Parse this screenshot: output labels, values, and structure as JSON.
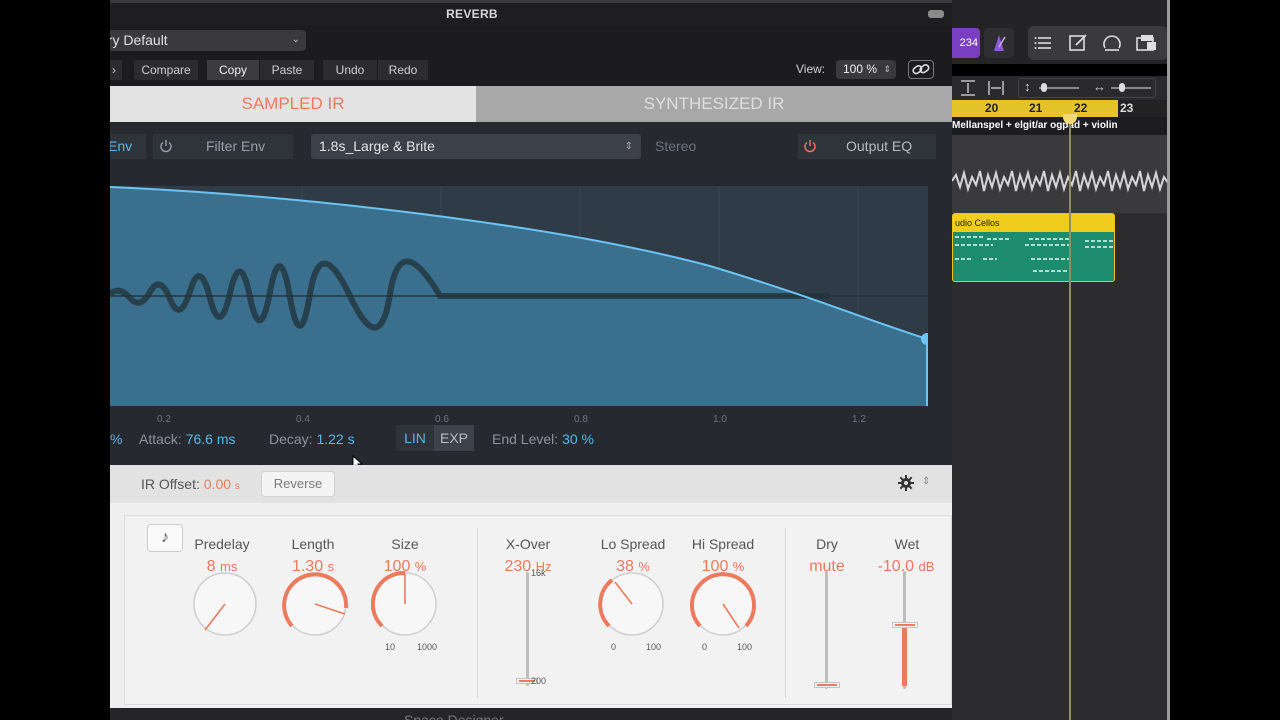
{
  "plugin": {
    "title": "REVERB",
    "preset": "ory Default",
    "toolbar": {
      "arrow": "›",
      "compare": "Compare",
      "copy": "Copy",
      "paste": "Paste",
      "undo": "Undo",
      "redo": "Redo",
      "view_label": "View:",
      "view_value": "100 %"
    },
    "tabs": {
      "sampled": "SAMPLED IR",
      "synthesized": "SYNTHESIZED IR"
    },
    "envelope": {
      "env_tab": "Env",
      "filter_env": "Filter Env",
      "ir_name": "1.8s_Large & Brite",
      "stereo": "Stereo",
      "output_eq": "Output EQ",
      "x_ticks": [
        "0.2",
        "0.4",
        "0.6",
        "0.8",
        "1.0",
        "1.2"
      ],
      "pct_fragment": "%",
      "attack_label": "Attack:",
      "attack_value": "76.6 ms",
      "decay_label": "Decay:",
      "decay_value": "1.22 s",
      "lin": "LIN",
      "exp": "EXP",
      "end_level_label": "End Level:",
      "end_level_value": "30 %"
    },
    "offset": {
      "label": "IR Offset:",
      "value": "0.00",
      "unit": "s",
      "reverse": "Reverse"
    },
    "knobs": {
      "predelay": {
        "label": "Predelay",
        "value": "8",
        "unit": "ms"
      },
      "length": {
        "label": "Length",
        "value": "1.30",
        "unit": "s"
      },
      "size": {
        "label": "Size",
        "value": "100",
        "unit": "%",
        "min": "10",
        "max": "1000"
      },
      "xover": {
        "label": "X-Over",
        "value": "230",
        "unit": "Hz",
        "top": "16k",
        "bottom": "200"
      },
      "lo_spread": {
        "label": "Lo Spread",
        "value": "38",
        "unit": "%",
        "min": "0",
        "max": "100"
      },
      "hi_spread": {
        "label": "Hi Spread",
        "value": "100",
        "unit": "%",
        "min": "0",
        "max": "100"
      },
      "dry": {
        "label": "Dry",
        "value": "mute"
      },
      "wet": {
        "label": "Wet",
        "value": "-10.0",
        "unit": "dB"
      }
    },
    "bottom_text": "Space Designer"
  },
  "daw": {
    "lcd": "234",
    "ruler": [
      "20",
      "21",
      "22",
      "23"
    ],
    "region_names": "Mellanspel + elgit/ar  ogpad    + violin",
    "midi_region": "udio Cellos"
  },
  "colors": {
    "accent_orange": "#ee7a5d",
    "accent_blue": "#5db5e8",
    "ruler_yellow": "#e4c229",
    "midi_green": "#1d8c6e"
  }
}
